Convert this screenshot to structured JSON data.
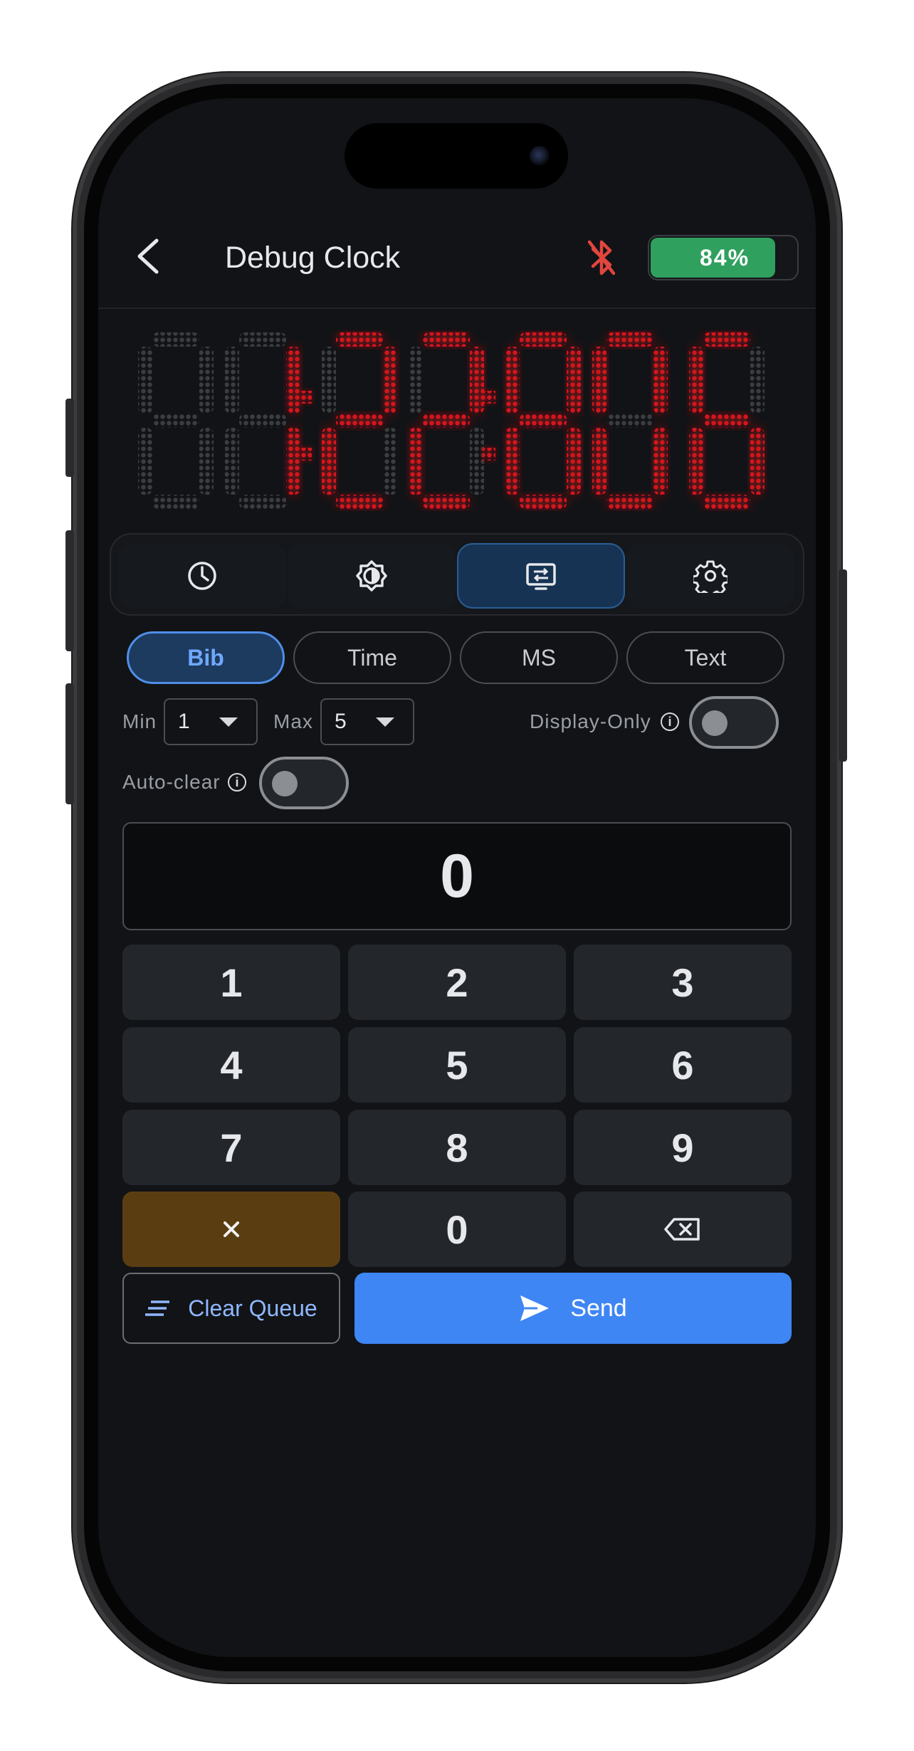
{
  "header": {
    "title": "Debug Clock",
    "bluetooth_icon": "bluetooth-disconnected-icon",
    "battery_percent": "84%",
    "battery_level": 0.84,
    "battery_color": "#2fa05e",
    "bluetooth_color": "#e2463d"
  },
  "led_display": {
    "time": "12:28:06",
    "color": "#e01a1a"
  },
  "tabs": [
    {
      "icon": "clock-icon",
      "active": false
    },
    {
      "icon": "brightness-icon",
      "active": false
    },
    {
      "icon": "input-bib-icon",
      "active": true
    },
    {
      "icon": "settings-icon",
      "active": false
    }
  ],
  "modes": [
    {
      "label": "Bib",
      "active": true
    },
    {
      "label": "Time",
      "active": false
    },
    {
      "label": "MS",
      "active": false
    },
    {
      "label": "Text",
      "active": false
    }
  ],
  "options": {
    "min_label": "Min",
    "min_value": "1",
    "max_label": "Max",
    "max_value": "5",
    "display_only_label": "Display-Only",
    "display_only_on": false,
    "auto_clear_label": "Auto-clear",
    "auto_clear_on": false
  },
  "entry": {
    "value": "0"
  },
  "keypad": {
    "keys": [
      "1",
      "2",
      "3",
      "4",
      "5",
      "6",
      "7",
      "8",
      "9",
      "0"
    ],
    "clear_icon": "close-icon",
    "backspace_icon": "backspace-icon",
    "clear_color": "#5a3e11"
  },
  "actions": {
    "clear_queue_label": "Clear Queue",
    "clear_queue_icon": "queue-clear-icon",
    "send_label": "Send",
    "send_icon": "send-icon",
    "send_color": "#3f86f5"
  }
}
